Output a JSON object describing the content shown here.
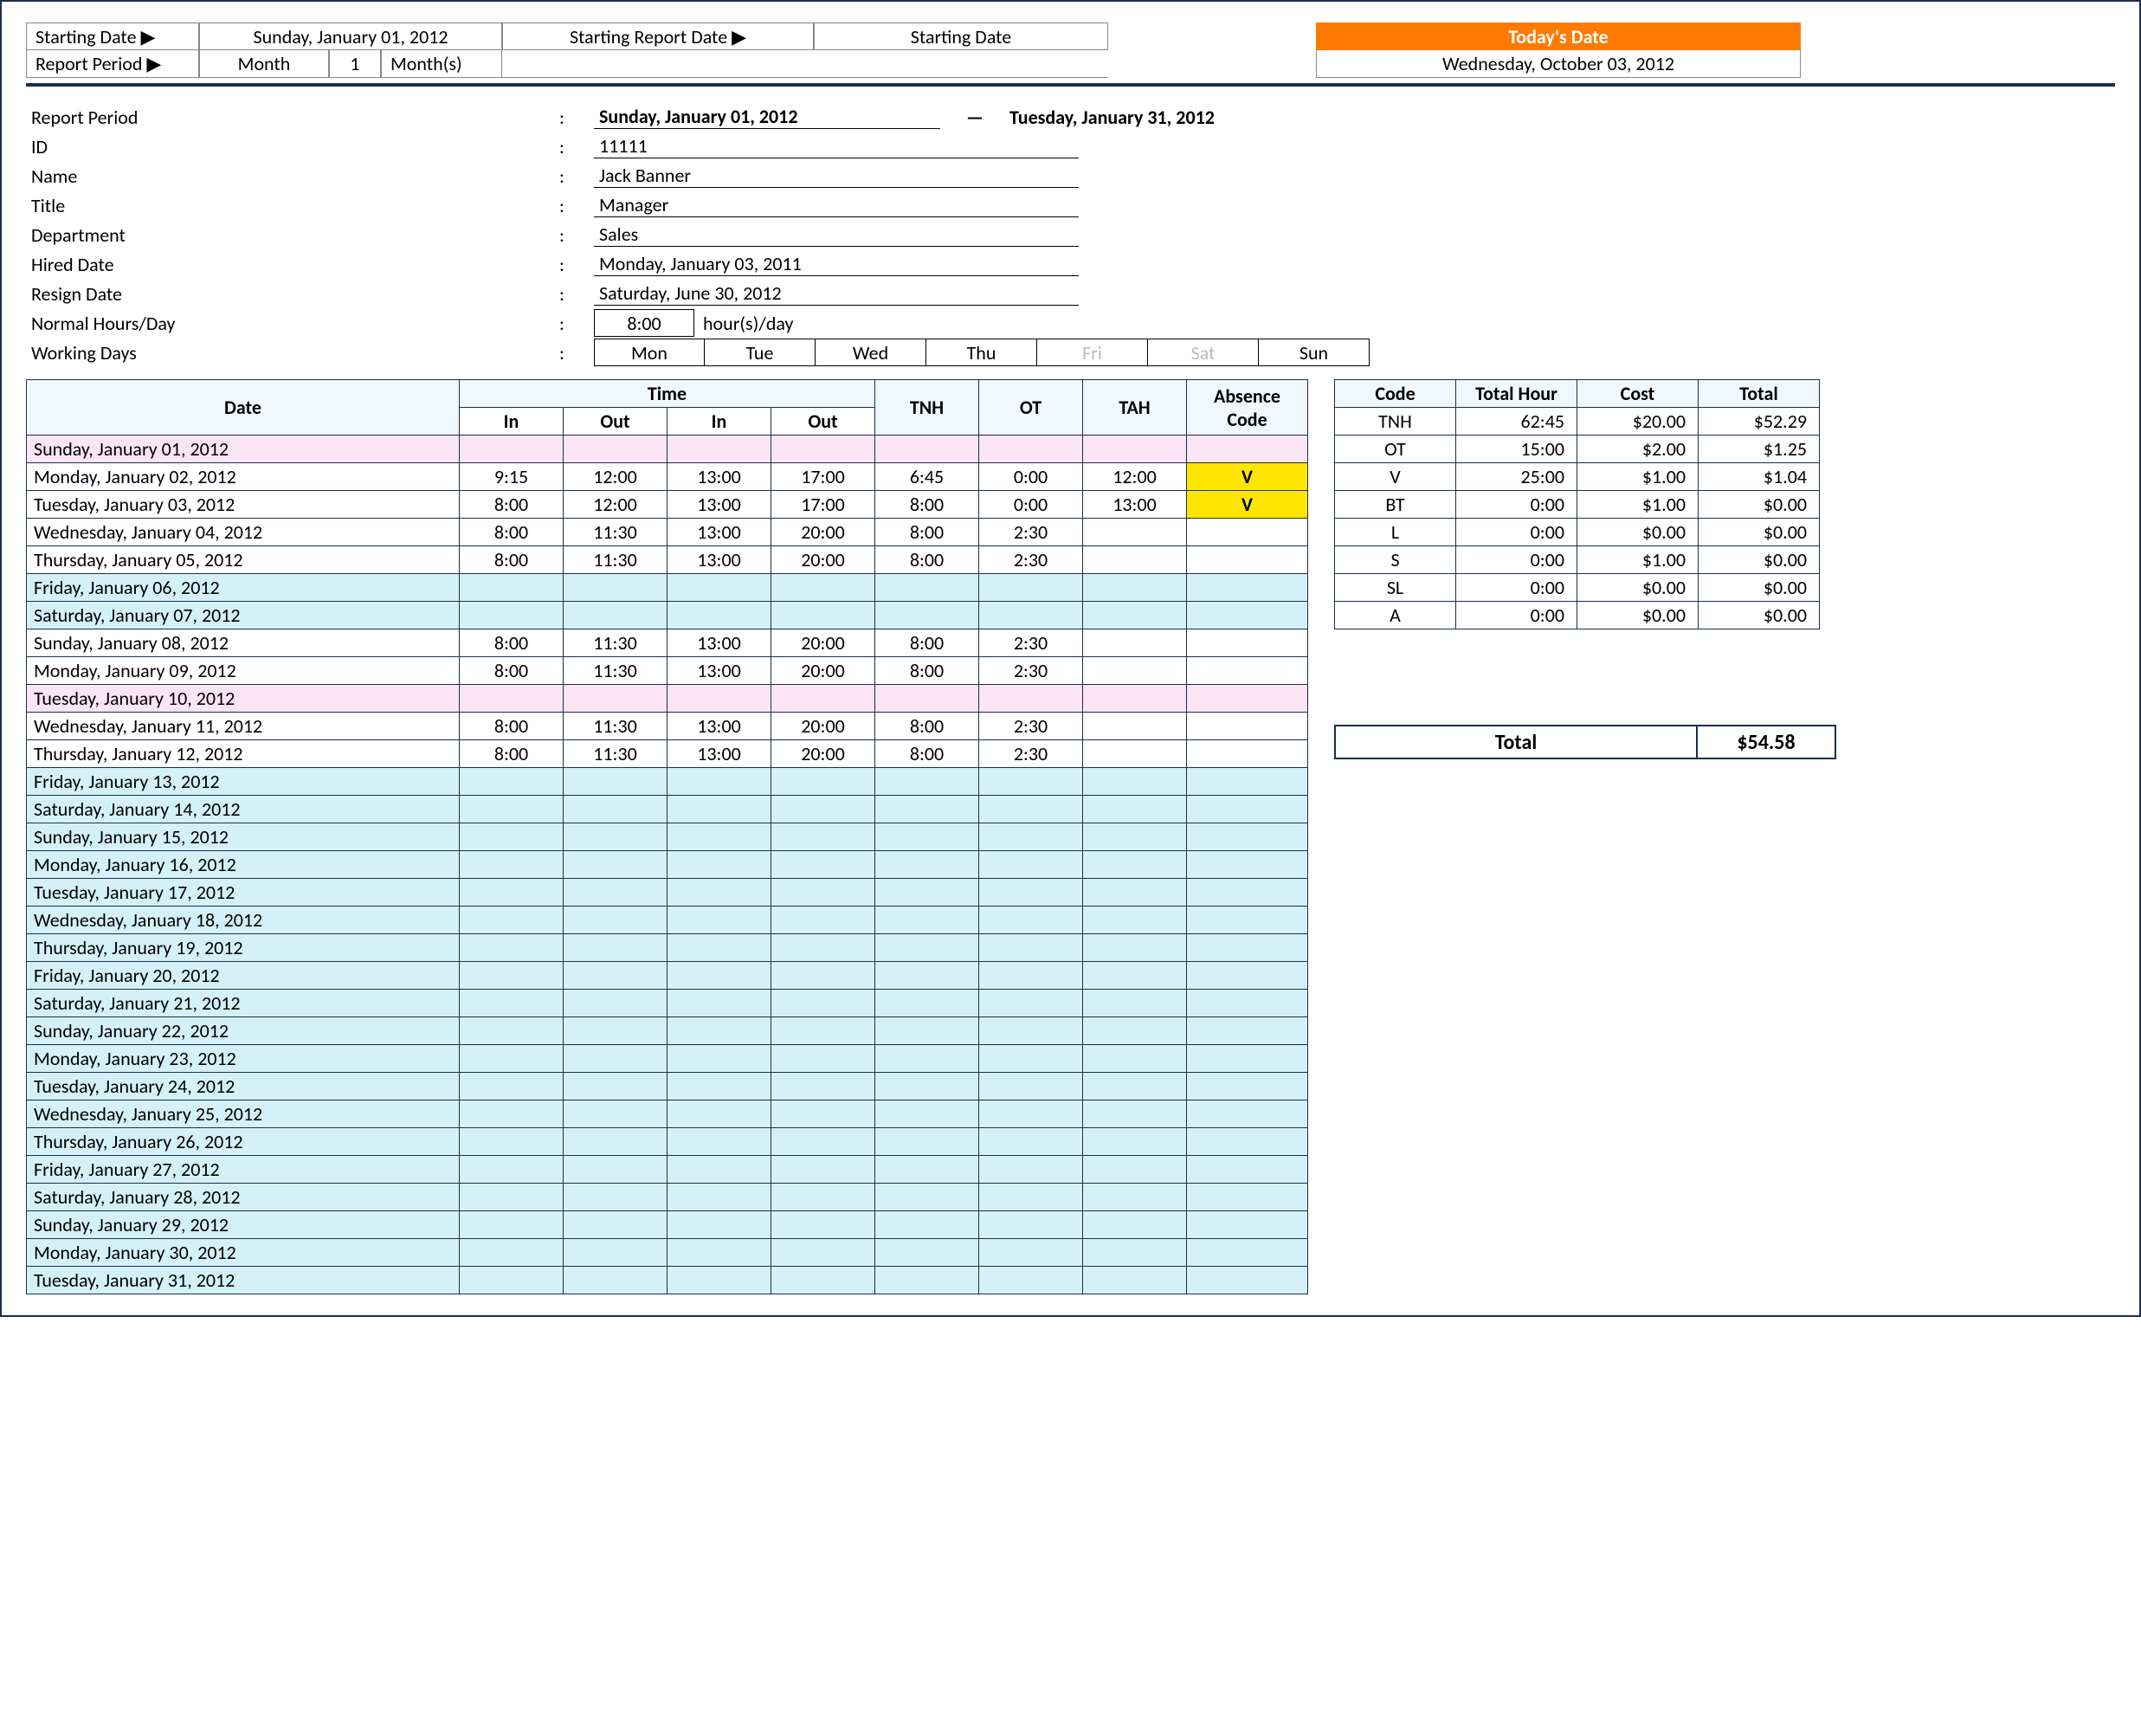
{
  "top": {
    "starting_date_lbl": "Starting Date ▶",
    "starting_date": "Sunday, January 01, 2012",
    "starting_report_lbl": "Starting Report Date ▶",
    "starting_report_val": "Starting Date",
    "today_lbl": "Today's Date",
    "today_val": "Wednesday, October 03, 2012",
    "report_period_lbl": "Report Period ▶",
    "report_period_type": "Month",
    "report_period_n": "1",
    "report_period_unit": "Month(s)"
  },
  "info": {
    "report_period_lbl": "Report Period",
    "report_period_from": "Sunday, January 01, 2012",
    "report_period_to": "Tuesday, January 31, 2012",
    "id_lbl": "ID",
    "id": "11111",
    "name_lbl": "Name",
    "name": "Jack Banner",
    "title_lbl": "Title",
    "title": "Manager",
    "dept_lbl": "Department",
    "dept": "Sales",
    "hired_lbl": "Hired Date",
    "hired": "Monday, January 03, 2011",
    "resign_lbl": "Resign Date",
    "resign": "Saturday, June 30, 2012",
    "hours_lbl": "Normal Hours/Day",
    "hours_val": "8:00",
    "hours_unit": "hour(s)/day",
    "days_lbl": "Working Days",
    "days": [
      "Mon",
      "Tue",
      "Wed",
      "Thu",
      "Fri",
      "Sat",
      "Sun"
    ],
    "days_off": [
      false,
      false,
      false,
      false,
      true,
      true,
      false
    ]
  },
  "ts": {
    "headers": {
      "date": "Date",
      "time": "Time",
      "in": "In",
      "out": "Out",
      "tnh": "TNH",
      "ot": "OT",
      "tah": "TAH",
      "abs": "Absence Code"
    },
    "rows": [
      {
        "date": "Sunday, January 01, 2012",
        "cls": "holiday"
      },
      {
        "date": "Monday, January 02, 2012",
        "in1": "9:15",
        "out1": "12:00",
        "in2": "13:00",
        "out2": "17:00",
        "tnh": "6:45",
        "ot": "0:00",
        "tah": "12:00",
        "abs": "V",
        "abs_hl": true
      },
      {
        "date": "Tuesday, January 03, 2012",
        "in1": "8:00",
        "out1": "12:00",
        "in2": "13:00",
        "out2": "17:00",
        "tnh": "8:00",
        "ot": "0:00",
        "tah": "13:00",
        "abs": "V",
        "abs_hl": true
      },
      {
        "date": "Wednesday, January 04, 2012",
        "in1": "8:00",
        "out1": "11:30",
        "in2": "13:00",
        "out2": "20:00",
        "tnh": "8:00",
        "ot": "2:30"
      },
      {
        "date": "Thursday, January 05, 2012",
        "in1": "8:00",
        "out1": "11:30",
        "in2": "13:00",
        "out2": "20:00",
        "tnh": "8:00",
        "ot": "2:30"
      },
      {
        "date": "Friday, January 06, 2012",
        "cls": "weekend"
      },
      {
        "date": "Saturday, January 07, 2012",
        "cls": "weekend"
      },
      {
        "date": "Sunday, January 08, 2012",
        "in1": "8:00",
        "out1": "11:30",
        "in2": "13:00",
        "out2": "20:00",
        "tnh": "8:00",
        "ot": "2:30"
      },
      {
        "date": "Monday, January 09, 2012",
        "in1": "8:00",
        "out1": "11:30",
        "in2": "13:00",
        "out2": "20:00",
        "tnh": "8:00",
        "ot": "2:30"
      },
      {
        "date": "Tuesday, January 10, 2012",
        "cls": "holiday"
      },
      {
        "date": "Wednesday, January 11, 2012",
        "in1": "8:00",
        "out1": "11:30",
        "in2": "13:00",
        "out2": "20:00",
        "tnh": "8:00",
        "ot": "2:30"
      },
      {
        "date": "Thursday, January 12, 2012",
        "in1": "8:00",
        "out1": "11:30",
        "in2": "13:00",
        "out2": "20:00",
        "tnh": "8:00",
        "ot": "2:30"
      },
      {
        "date": "Friday, January 13, 2012",
        "cls": "weekend"
      },
      {
        "date": "Saturday, January 14, 2012",
        "cls": "weekend"
      },
      {
        "date": "Sunday, January 15, 2012",
        "cls": "weekend"
      },
      {
        "date": "Monday, January 16, 2012",
        "cls": "weekend"
      },
      {
        "date": "Tuesday, January 17, 2012",
        "cls": "weekend"
      },
      {
        "date": "Wednesday, January 18, 2012",
        "cls": "weekend"
      },
      {
        "date": "Thursday, January 19, 2012",
        "cls": "weekend"
      },
      {
        "date": "Friday, January 20, 2012",
        "cls": "weekend"
      },
      {
        "date": "Saturday, January 21, 2012",
        "cls": "weekend"
      },
      {
        "date": "Sunday, January 22, 2012",
        "cls": "weekend"
      },
      {
        "date": "Monday, January 23, 2012",
        "cls": "weekend"
      },
      {
        "date": "Tuesday, January 24, 2012",
        "cls": "weekend"
      },
      {
        "date": "Wednesday, January 25, 2012",
        "cls": "weekend"
      },
      {
        "date": "Thursday, January 26, 2012",
        "cls": "weekend"
      },
      {
        "date": "Friday, January 27, 2012",
        "cls": "weekend"
      },
      {
        "date": "Saturday, January 28, 2012",
        "cls": "weekend"
      },
      {
        "date": "Sunday, January 29, 2012",
        "cls": "weekend"
      },
      {
        "date": "Monday, January 30, 2012",
        "cls": "weekend"
      },
      {
        "date": "Tuesday, January 31, 2012",
        "cls": "weekend"
      }
    ]
  },
  "summary": {
    "headers": {
      "code": "Code",
      "hour": "Total Hour",
      "cost": "Cost",
      "total": "Total"
    },
    "rows": [
      {
        "code": "TNH",
        "hour": "62:45",
        "cost": "$20.00",
        "total": "$52.29"
      },
      {
        "code": "OT",
        "hour": "15:00",
        "cost": "$2.00",
        "total": "$1.25"
      },
      {
        "code": "V",
        "hour": "25:00",
        "cost": "$1.00",
        "total": "$1.04"
      },
      {
        "code": "BT",
        "hour": "0:00",
        "cost": "$1.00",
        "total": "$0.00"
      },
      {
        "code": "L",
        "hour": "0:00",
        "cost": "$0.00",
        "total": "$0.00"
      },
      {
        "code": "S",
        "hour": "0:00",
        "cost": "$1.00",
        "total": "$0.00"
      },
      {
        "code": "SL",
        "hour": "0:00",
        "cost": "$0.00",
        "total": "$0.00"
      },
      {
        "code": "A",
        "hour": "0:00",
        "cost": "$0.00",
        "total": "$0.00"
      }
    ],
    "grand_lbl": "Total",
    "grand_total": "$54.58"
  }
}
